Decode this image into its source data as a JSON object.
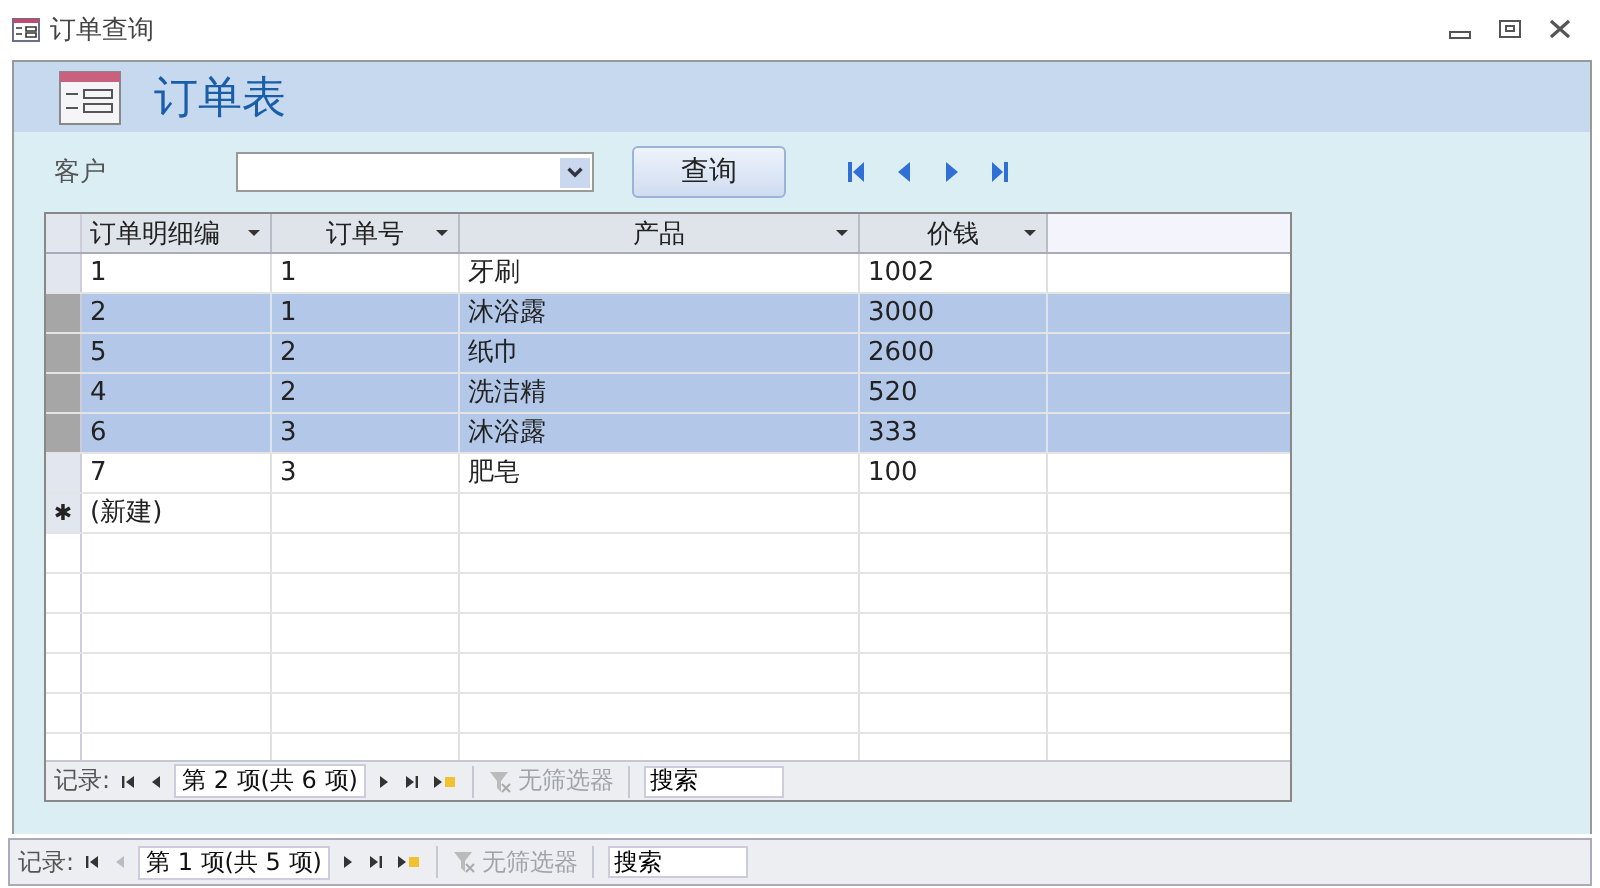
{
  "window": {
    "title": "订单查询"
  },
  "form": {
    "title": "订单表",
    "customer_label": "客户",
    "query_button": "查询",
    "nav_buttons": [
      {
        "kind": "first"
      },
      {
        "kind": "prev"
      },
      {
        "kind": "next"
      },
      {
        "kind": "last"
      }
    ]
  },
  "table": {
    "columns": [
      "订单明细编",
      "订单号",
      "产品",
      "价钱"
    ],
    "rows": [
      {
        "cells": [
          "1",
          "1",
          "牙刷",
          "1002"
        ],
        "selected": false
      },
      {
        "cells": [
          "2",
          "1",
          "沐浴露",
          "3000"
        ],
        "selected": true
      },
      {
        "cells": [
          "5",
          "2",
          "纸巾",
          "2600"
        ],
        "selected": true
      },
      {
        "cells": [
          "4",
          "2",
          "洗洁精",
          "520"
        ],
        "selected": true
      },
      {
        "cells": [
          "6",
          "3",
          "沐浴露",
          "333"
        ],
        "selected": true
      },
      {
        "cells": [
          "7",
          "3",
          "肥皂",
          "100"
        ],
        "selected": false
      }
    ],
    "new_row_marker": "✱",
    "new_row_label": "(新建)"
  },
  "inner_nav": {
    "label": "记录:",
    "position": "第 2 项(共 6 项)",
    "first_disabled": false,
    "prev_disabled": false,
    "filter": "无筛选器",
    "filter_disabled": true,
    "search": "搜索"
  },
  "outer_nav": {
    "label": "记录:",
    "position": "第 1 项(共 5 项)",
    "first_disabled": false,
    "prev_disabled": true,
    "filter": "无筛选器",
    "filter_disabled": true,
    "search": "搜索"
  }
}
